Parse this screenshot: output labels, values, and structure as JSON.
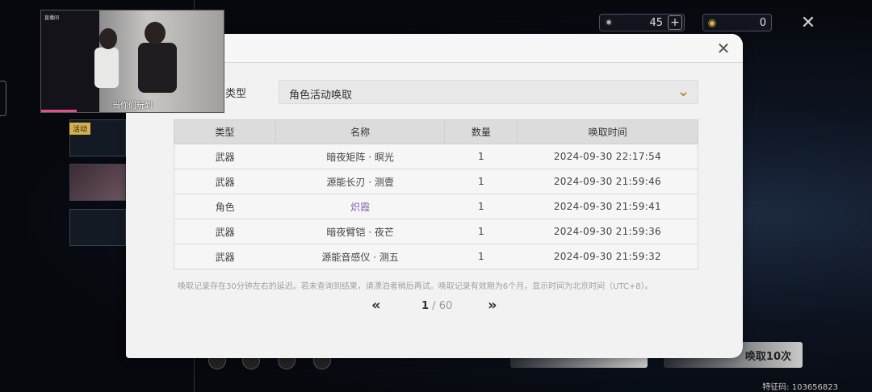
{
  "currencies": [
    {
      "icon": "star-crystal-icon",
      "value": "45"
    },
    {
      "icon": "coin-icon",
      "value": "0"
    }
  ],
  "stream": {
    "channel": "直播间",
    "caption": "当你们玩到"
  },
  "background": {
    "tag": "活动",
    "feature_code": "特征码: 103656823",
    "pull_ten_label": "唤取10次"
  },
  "modal": {
    "type_label": "类型",
    "selected_type": "角色活动唤取",
    "columns": [
      "类型",
      "名称",
      "数量",
      "唤取时间"
    ],
    "rows": [
      {
        "type": "武器",
        "name": "暗夜矩阵 · 暝光",
        "qty": "1",
        "time": "2024-09-30 22:17:54",
        "highlight": false
      },
      {
        "type": "武器",
        "name": "源能长刃 · 测壹",
        "qty": "1",
        "time": "2024-09-30 21:59:46",
        "highlight": false
      },
      {
        "type": "角色",
        "name": "炽霞",
        "qty": "1",
        "time": "2024-09-30 21:59:41",
        "highlight": true
      },
      {
        "type": "武器",
        "name": "暗夜臂铠 · 夜芒",
        "qty": "1",
        "time": "2024-09-30 21:59:36",
        "highlight": false
      },
      {
        "type": "武器",
        "name": "源能音感仪 · 测五",
        "qty": "1",
        "time": "2024-09-30 21:59:32",
        "highlight": false
      }
    ],
    "note": "唤取记录存在30分钟左右的延迟。若未查询到结果，请漂泊者稍后再试。唤取记录有效期为6个月，显示时间为北京时间（UTC+8）。",
    "pager": {
      "current": "1",
      "separator": " / ",
      "total": "60"
    }
  },
  "colors": {
    "accent": "#b08a2a",
    "character": "#8a5fb0"
  }
}
